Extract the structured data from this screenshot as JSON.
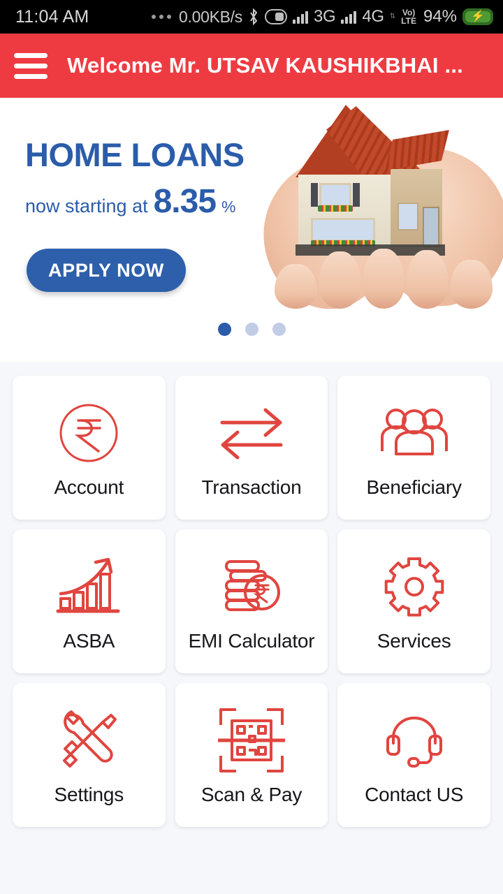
{
  "status_bar": {
    "time": "11:04 AM",
    "overflow_icon": "more-dots-icon",
    "network_speed": "0.00KB/s",
    "bluetooth_icon": "bluetooth-icon",
    "dnd_icon": "do-not-disturb-icon",
    "sim1_network": "3G",
    "sim2_network": "4G",
    "volte_top": "Vo)",
    "volte_bottom": "LTE",
    "battery_percent": "94%",
    "battery_icon": "battery-charging-icon"
  },
  "app_bar": {
    "menu_icon": "hamburger-menu-icon",
    "title": "Welcome Mr. UTSAV KAUSHIKBHAI ...",
    "background_color": "#ee3b42"
  },
  "banner": {
    "title": "HOME LOANS",
    "sub_lead": "now starting at",
    "rate": "8.35",
    "percent_symbol": "%",
    "cta_label": "APPLY NOW",
    "accent_color": "#2a5caa",
    "cta_color": "#2e5fab",
    "image_alt": "hands-holding-model-house",
    "dots": [
      {
        "active": true
      },
      {
        "active": false
      },
      {
        "active": false
      }
    ]
  },
  "menu_grid": {
    "accent_color": "#e0453f",
    "tiles": [
      {
        "label": "Account",
        "icon": "rupee-circle-icon"
      },
      {
        "label": "Transaction",
        "icon": "transfer-arrows-icon"
      },
      {
        "label": "Beneficiary",
        "icon": "people-group-icon"
      },
      {
        "label": "ASBA",
        "icon": "growth-chart-icon"
      },
      {
        "label": "EMI Calculator",
        "icon": "coins-rupee-icon"
      },
      {
        "label": "Services",
        "icon": "gear-icon"
      },
      {
        "label": "Settings",
        "icon": "tools-icon"
      },
      {
        "label": "Scan & Pay",
        "icon": "qr-scan-icon"
      },
      {
        "label": "Contact US",
        "icon": "headset-icon"
      }
    ]
  }
}
